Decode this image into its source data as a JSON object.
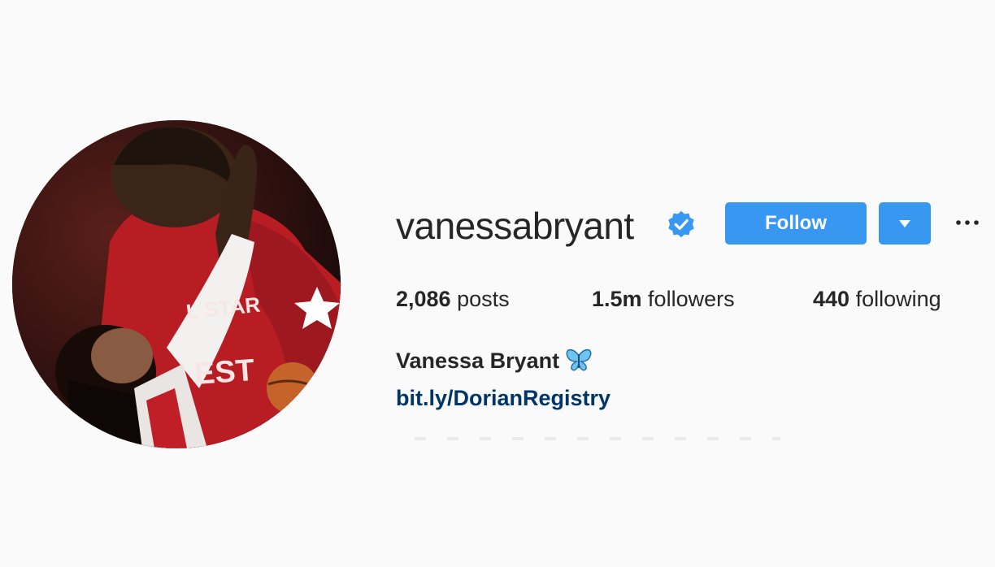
{
  "profile": {
    "username": "vanessabryant",
    "display_name": "Vanessa Bryant",
    "link": "bit.ly/DorianRegistry",
    "bio_emoji": "butterfly-icon"
  },
  "actions": {
    "follow_label": "Follow"
  },
  "stats": {
    "posts_count": "2,086",
    "posts_label": " posts",
    "followers_count": "1.5m",
    "followers_label": " followers",
    "following_count": "440",
    "following_label": " following"
  },
  "colors": {
    "accent": "#3897f0",
    "link": "#003569",
    "text": "#262626",
    "background": "#fafafa"
  },
  "icons": [
    "verified-badge-icon",
    "chevron-down-icon",
    "more-options-icon",
    "butterfly-icon"
  ]
}
